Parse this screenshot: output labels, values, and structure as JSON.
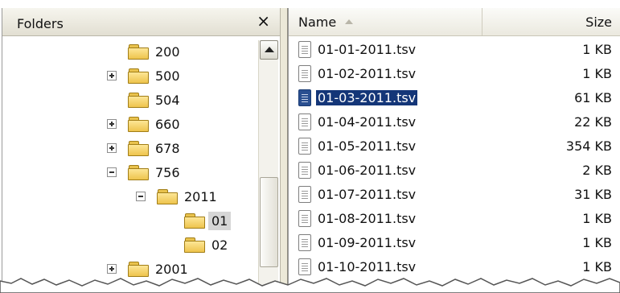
{
  "folders_pane": {
    "title": "Folders",
    "close_glyph": "×",
    "tree": [
      {
        "label": "200",
        "level": 0,
        "expander": "none"
      },
      {
        "label": "500",
        "level": 0,
        "expander": "plus"
      },
      {
        "label": "504",
        "level": 0,
        "expander": "none"
      },
      {
        "label": "660",
        "level": 0,
        "expander": "plus"
      },
      {
        "label": "678",
        "level": 0,
        "expander": "plus"
      },
      {
        "label": "756",
        "level": 0,
        "expander": "minus"
      },
      {
        "label": "2011",
        "level": 1,
        "expander": "minus"
      },
      {
        "label": "01",
        "level": 2,
        "expander": "none",
        "selected": true
      },
      {
        "label": "02",
        "level": 2,
        "expander": "none"
      },
      {
        "label": "2001",
        "level": 0,
        "expander": "plus"
      }
    ]
  },
  "file_list": {
    "columns": {
      "name": "Name",
      "size": "Size"
    },
    "files": [
      {
        "name": "01-01-2011.tsv",
        "size": "1 KB"
      },
      {
        "name": "01-02-2011.tsv",
        "size": "1 KB"
      },
      {
        "name": "01-03-2011.tsv",
        "size": "61 KB",
        "selected": true
      },
      {
        "name": "01-04-2011.tsv",
        "size": "22 KB"
      },
      {
        "name": "01-05-2011.tsv",
        "size": "354 KB"
      },
      {
        "name": "01-06-2011.tsv",
        "size": "2 KB"
      },
      {
        "name": "01-07-2011.tsv",
        "size": "31 KB"
      },
      {
        "name": "01-08-2011.tsv",
        "size": "1 KB"
      },
      {
        "name": "01-09-2011.tsv",
        "size": "1 KB"
      },
      {
        "name": "01-10-2011.tsv",
        "size": "1 KB"
      }
    ]
  },
  "colors": {
    "selection_bg": "#143678",
    "selection_text": "#ffffff",
    "folder_fill": "#f3d064",
    "header_bg": "#ebe9df"
  },
  "icons": {
    "folder": "folder-icon",
    "file": "tsv-file-icon",
    "expand": "expand-plus-icon",
    "collapse": "collapse-minus-icon",
    "close": "close-icon",
    "sort": "sort-ascending-icon",
    "scroll_up": "scroll-up-arrow-icon"
  }
}
